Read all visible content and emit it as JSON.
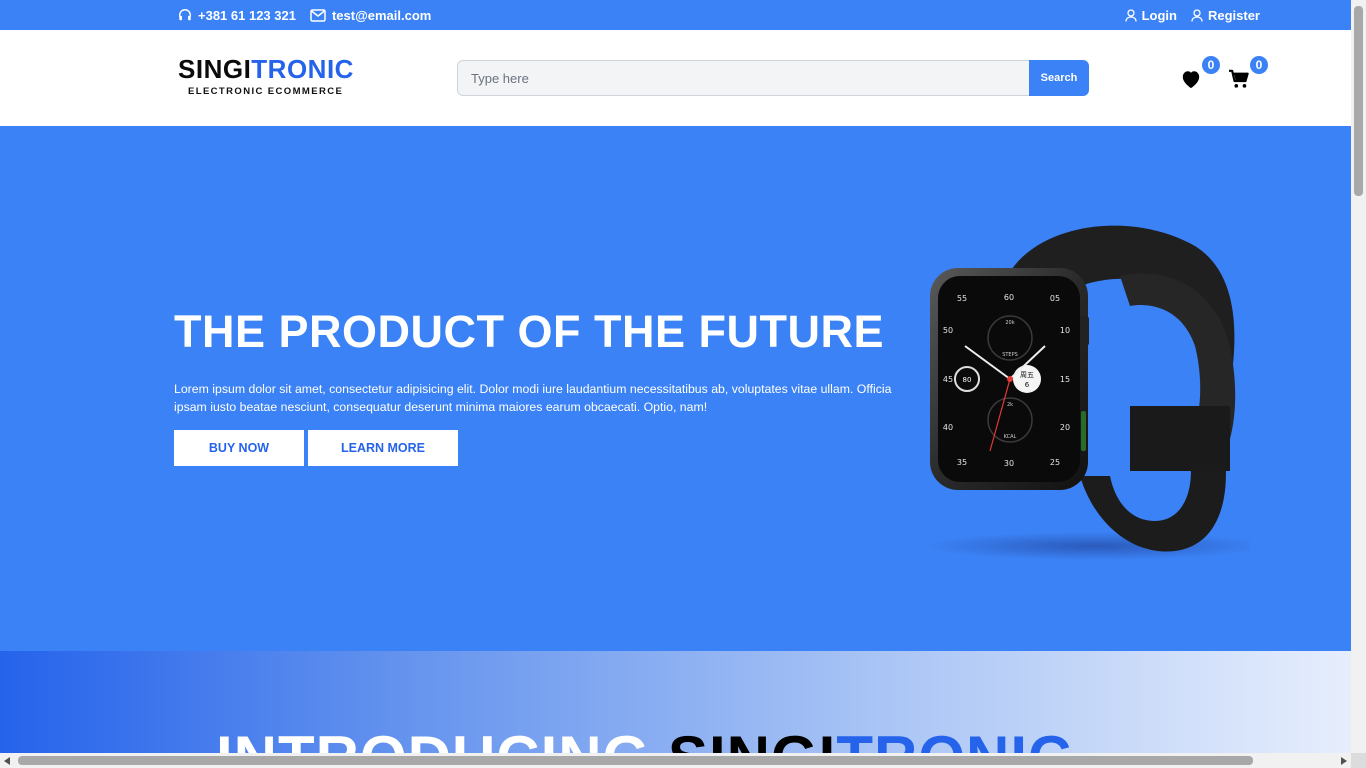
{
  "topbar": {
    "phone": "+381 61 123 321",
    "email": "test@email.com",
    "login_label": "Login",
    "register_label": "Register"
  },
  "header": {
    "logo_part1": "SINGI",
    "logo_part2": "TRONIC",
    "tagline": "ELECTRONIC ECOMMERCE",
    "search_placeholder": "Type here",
    "search_button": "Search",
    "wishlist_count": "0",
    "cart_count": "0"
  },
  "hero": {
    "title": "THE PRODUCT OF THE FUTURE",
    "description": "Lorem ipsum dolor sit amet, consectetur adipisicing elit. Dolor modi iure laudantium necessitatibus ab, voluptates vitae ullam. Officia ipsam iusto beatae nesciunt, consequatur deserunt minima maiores earum obcaecati. Optio, nam!",
    "buy_label": "BUY NOW",
    "learn_label": "LEARN MORE",
    "watch": {
      "dial_numbers": [
        "55",
        "60",
        "05",
        "10",
        "15",
        "20",
        "25",
        "30",
        "35",
        "40",
        "45",
        "50"
      ],
      "date_chars": "周五",
      "date_num": "6",
      "sub_top": "20k",
      "sub_top_label": "STEPS",
      "sub_bottom": "2k",
      "sub_bottom_label": "KCAL",
      "sub_left": "80"
    }
  },
  "intro": {
    "word1": "INTRODUCING ",
    "word2": "SINGI",
    "word3": "TRONIC"
  },
  "colors": {
    "primary": "#3b82f6",
    "brand_blue": "#2563eb",
    "white": "#ffffff"
  },
  "icons": [
    "headset-icon",
    "mail-icon",
    "user-icon",
    "heart-icon",
    "cart-icon"
  ]
}
